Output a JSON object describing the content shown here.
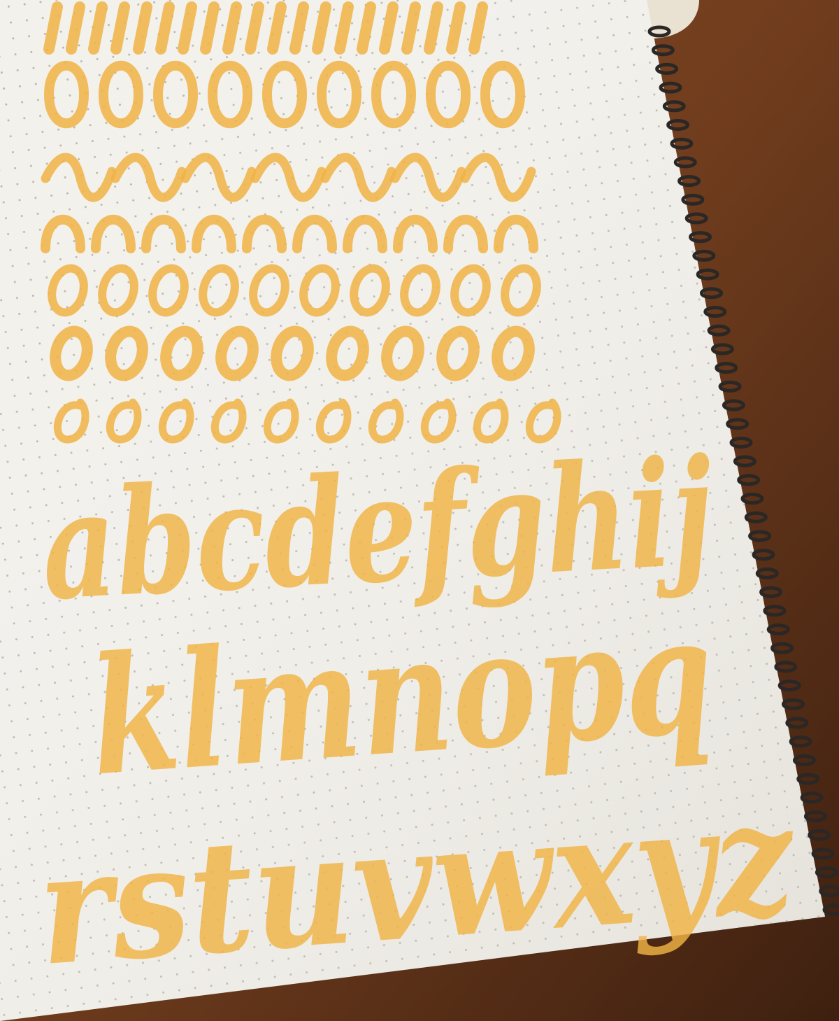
{
  "photo": {
    "subject": "dot-grid spiral notebook brush-lettering practice sheet",
    "ink_color": "#f0b344",
    "paper_color": "#f3f1ec",
    "dot_color": "#b9b6ae",
    "table_color": "#7a4421",
    "spiral_color": "#2b2725"
  },
  "lettering": {
    "line_1": "abcdefghij",
    "line_2": "klmnopq",
    "line_3": "rstuvwxyz"
  },
  "drill_rows": [
    {
      "kind": "downstroke",
      "count": 20
    },
    {
      "kind": "overturn-underturn",
      "count": 9
    },
    {
      "kind": "wave",
      "count": 7
    },
    {
      "kind": "overturn",
      "count": 10
    },
    {
      "kind": "oval",
      "count": 10
    },
    {
      "kind": "oval-thick",
      "count": 9
    },
    {
      "kind": "oval-loop",
      "count": 10
    }
  ]
}
